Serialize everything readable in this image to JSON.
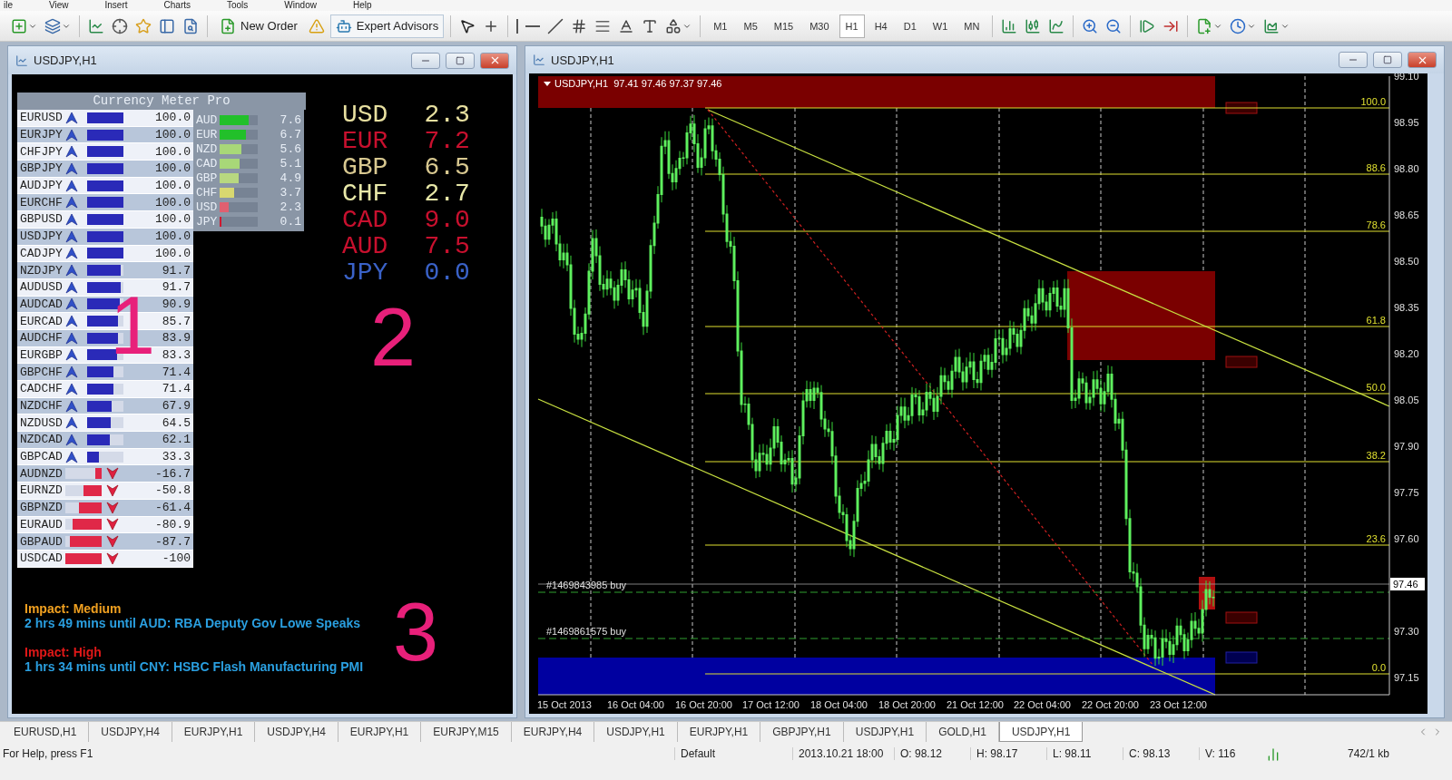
{
  "menu": [
    "ile",
    "View",
    "Insert",
    "Charts",
    "Tools",
    "Window",
    "Help"
  ],
  "toolbar": {
    "new_order": "New Order",
    "expert_advisors": "Expert Advisors",
    "timeframes": [
      {
        "label": "M1",
        "selected": false
      },
      {
        "label": "M5",
        "selected": false
      },
      {
        "label": "M15",
        "selected": false
      },
      {
        "label": "M30",
        "selected": false
      },
      {
        "label": "H1",
        "selected": true
      },
      {
        "label": "H4",
        "selected": false
      },
      {
        "label": "D1",
        "selected": false
      },
      {
        "label": "W1",
        "selected": false
      },
      {
        "label": "MN",
        "selected": false
      }
    ]
  },
  "left_window": {
    "title": "USDJPY,H1",
    "meter": {
      "title": "Currency Meter Pro",
      "pairs": [
        {
          "pair": "EURUSD",
          "kind": "up",
          "level": 1.0,
          "value": "100.0"
        },
        {
          "pair": "EURJPY",
          "kind": "up",
          "level": 1.0,
          "value": "100.0"
        },
        {
          "pair": "CHFJPY",
          "kind": "up",
          "level": 1.0,
          "value": "100.0"
        },
        {
          "pair": "GBPJPY",
          "kind": "up",
          "level": 1.0,
          "value": "100.0"
        },
        {
          "pair": "AUDJPY",
          "kind": "up",
          "level": 1.0,
          "value": "100.0"
        },
        {
          "pair": "EURCHF",
          "kind": "up",
          "level": 1.0,
          "value": "100.0"
        },
        {
          "pair": "GBPUSD",
          "kind": "up",
          "level": 1.0,
          "value": "100.0"
        },
        {
          "pair": "USDJPY",
          "kind": "up",
          "level": 1.0,
          "value": "100.0"
        },
        {
          "pair": "CADJPY",
          "kind": "up",
          "level": 1.0,
          "value": "100.0"
        },
        {
          "pair": "NZDJPY",
          "kind": "up",
          "level": 0.917,
          "value": "91.7"
        },
        {
          "pair": "AUDUSD",
          "kind": "up",
          "level": 0.917,
          "value": "91.7"
        },
        {
          "pair": "AUDCAD",
          "kind": "up",
          "level": 0.909,
          "value": "90.9"
        },
        {
          "pair": "EURCAD",
          "kind": "up",
          "level": 0.857,
          "value": "85.7"
        },
        {
          "pair": "AUDCHF",
          "kind": "up",
          "level": 0.839,
          "value": "83.9"
        },
        {
          "pair": "EURGBP",
          "kind": "up",
          "level": 0.833,
          "value": "83.3"
        },
        {
          "pair": "GBPCHF",
          "kind": "up",
          "level": 0.714,
          "value": "71.4"
        },
        {
          "pair": "CADCHF",
          "kind": "up",
          "level": 0.714,
          "value": "71.4"
        },
        {
          "pair": "NZDCHF",
          "kind": "up",
          "level": 0.679,
          "value": "67.9"
        },
        {
          "pair": "NZDUSD",
          "kind": "up",
          "level": 0.645,
          "value": "64.5"
        },
        {
          "pair": "NZDCAD",
          "kind": "up",
          "level": 0.621,
          "value": "62.1"
        },
        {
          "pair": "GBPCAD",
          "kind": "up",
          "level": 0.333,
          "value": "33.3"
        },
        {
          "pair": "AUDNZD",
          "kind": "down",
          "level": 0.167,
          "value": "-16.7"
        },
        {
          "pair": "EURNZD",
          "kind": "down",
          "level": 0.508,
          "value": "-50.8"
        },
        {
          "pair": "GBPNZD",
          "kind": "down",
          "level": 0.614,
          "value": "-61.4"
        },
        {
          "pair": "EURAUD",
          "kind": "down",
          "level": 0.809,
          "value": "-80.9"
        },
        {
          "pair": "GBPAUD",
          "kind": "down",
          "level": 0.877,
          "value": "-87.7"
        },
        {
          "pair": "USDCAD",
          "kind": "down",
          "level": 1.0,
          "value": "-100"
        }
      ]
    },
    "strength": [
      {
        "currency": "AUD",
        "value": "7.6",
        "level": 0.76,
        "color": "#22c02a"
      },
      {
        "currency": "EUR",
        "value": "6.7",
        "level": 0.67,
        "color": "#22c02a"
      },
      {
        "currency": "NZD",
        "value": "5.6",
        "level": 0.56,
        "color": "#a8d878"
      },
      {
        "currency": "CAD",
        "value": "5.1",
        "level": 0.51,
        "color": "#a8d878"
      },
      {
        "currency": "GBP",
        "value": "4.9",
        "level": 0.49,
        "color": "#b8d880"
      },
      {
        "currency": "CHF",
        "value": "3.7",
        "level": 0.37,
        "color": "#d8d870"
      },
      {
        "currency": "USD",
        "value": "2.3",
        "level": 0.23,
        "color": "#e06070"
      },
      {
        "currency": "JPY",
        "value": "0.1",
        "level": 0.01,
        "color": "#d01830"
      }
    ],
    "scores": [
      {
        "currency": "USD",
        "value": "2.3",
        "color": "#e8e0a0"
      },
      {
        "currency": "EUR",
        "value": "7.2",
        "color": "#c8102e"
      },
      {
        "currency": "GBP",
        "value": "6.5",
        "color": "#d8c890"
      },
      {
        "currency": "CHF",
        "value": "2.7",
        "color": "#e8e8a8"
      },
      {
        "currency": "CAD",
        "value": "9.0",
        "color": "#c8102e"
      },
      {
        "currency": "AUD",
        "value": "7.5",
        "color": "#c8102e"
      },
      {
        "currency": "JPY",
        "value": "0.0",
        "color": "#3a62c8"
      }
    ],
    "news": [
      {
        "impact": "Impact: Medium",
        "color": "#f0a020",
        "text": "2 hrs 49 mins until AUD: RBA Deputy Gov Lowe Speaks"
      },
      {
        "impact": "Impact: High",
        "color": "#e01818",
        "text": "1 hrs 34 mins until CNY: HSBC Flash Manufacturing PMI"
      }
    ],
    "annotations": [
      "1",
      "2",
      "3"
    ]
  },
  "right_window": {
    "title": "USDJPY,H1",
    "chart_header": "USDJPY,H1  97.41 97.46 97.37 97.46",
    "price_axis": [
      "99.10",
      "98.95",
      "98.80",
      "98.65",
      "98.50",
      "98.35",
      "98.20",
      "98.05",
      "97.90",
      "97.75",
      "97.60",
      "97.30",
      "97.15"
    ],
    "fib_levels": [
      "100.0",
      "88.6",
      "78.6",
      "61.8",
      "50.0",
      "38.2",
      "23.6",
      "0.0"
    ],
    "orders": [
      "#1469843985 buy",
      "#1469861575 buy"
    ],
    "current_price": "97.46",
    "time_axis": [
      "15 Oct 2013",
      "16 Oct 04:00",
      "16 Oct 20:00",
      "17 Oct 12:00",
      "18 Oct 04:00",
      "18 Oct 20:00",
      "21 Oct 12:00",
      "22 Oct 04:00",
      "22 Oct 20:00",
      "23 Oct 12:00"
    ]
  },
  "tabs": [
    {
      "label": "EURUSD,H1",
      "selected": false
    },
    {
      "label": "USDJPY,H4",
      "selected": false
    },
    {
      "label": "EURJPY,H1",
      "selected": false
    },
    {
      "label": "USDJPY,H4",
      "selected": false
    },
    {
      "label": "EURJPY,H1",
      "selected": false
    },
    {
      "label": "EURJPY,M15",
      "selected": false
    },
    {
      "label": "EURJPY,H4",
      "selected": false
    },
    {
      "label": "USDJPY,H1",
      "selected": false
    },
    {
      "label": "EURJPY,H1",
      "selected": false
    },
    {
      "label": "GBPJPY,H1",
      "selected": false
    },
    {
      "label": "USDJPY,H1",
      "selected": false
    },
    {
      "label": "GOLD,H1",
      "selected": false
    },
    {
      "label": "USDJPY,H1",
      "selected": true
    }
  ],
  "status_bar": {
    "help": "For Help, press F1",
    "profile": "Default",
    "time": "2013.10.21 18:00",
    "open": "O: 98.12",
    "high": "H: 98.17",
    "low": "L: 98.11",
    "close": "C: 98.13",
    "volume": "V: 116",
    "traffic": "742/1 kb"
  }
}
